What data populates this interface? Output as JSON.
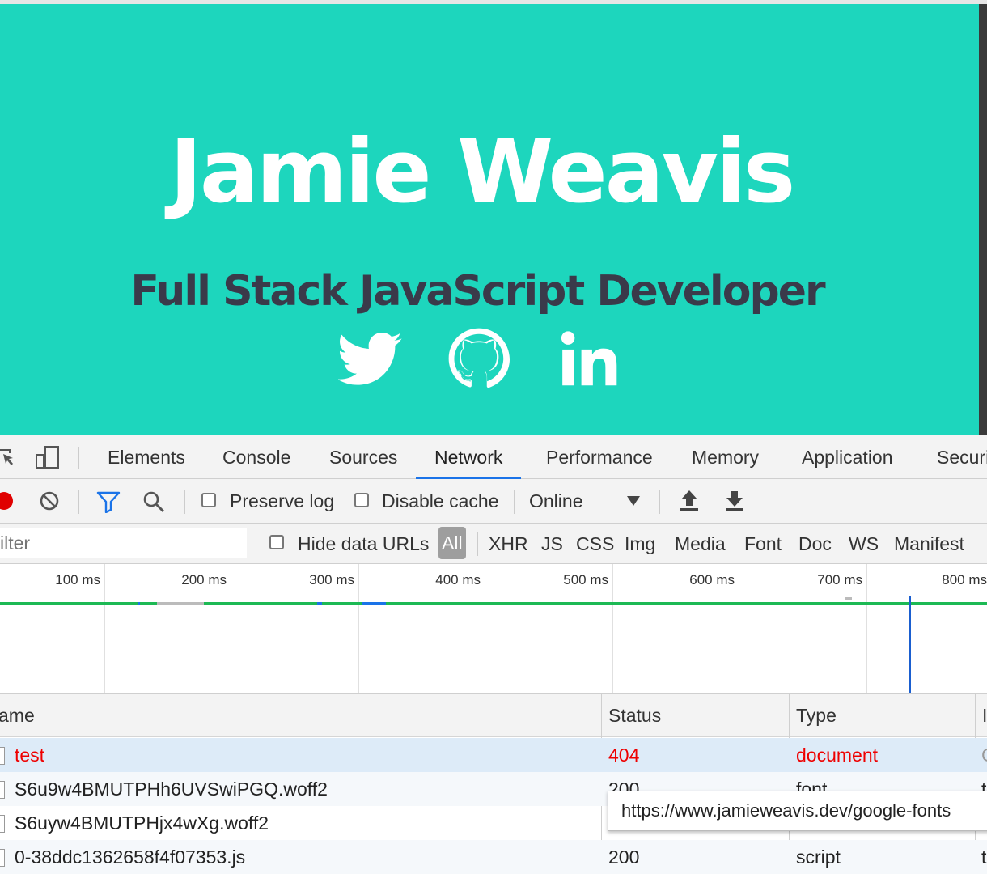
{
  "hero": {
    "background": "#1dd6bd",
    "name": "Jamie Weavis",
    "subtitle": "Full Stack JavaScript Developer",
    "social_icons": [
      "twitter-icon",
      "github-icon",
      "linkedin-icon"
    ]
  },
  "devtools": {
    "tabs": [
      "Elements",
      "Console",
      "Sources",
      "Network",
      "Performance",
      "Memory",
      "Application",
      "Securi"
    ],
    "active_tab": "Network",
    "toolbar": {
      "preserve_log": "Preserve log",
      "disable_cache": "Disable cache",
      "throttle": "Online"
    },
    "filter": {
      "placeholder": "ilter",
      "hide_data_urls": "Hide data URLs",
      "types": [
        "All",
        "XHR",
        "JS",
        "CSS",
        "Img",
        "Media",
        "Font",
        "Doc",
        "WS",
        "Manifest"
      ]
    },
    "timeline_ticks": [
      "100 ms",
      "200 ms",
      "300 ms",
      "400 ms",
      "500 ms",
      "600 ms",
      "700 ms",
      "800 ms"
    ],
    "columns": [
      "ame",
      "Status",
      "Type"
    ],
    "rows": [
      {
        "name": "test",
        "status": "404",
        "type": "document",
        "extra": "C"
      },
      {
        "name": "S6u9w4BMUTPHh6UVSwiPGQ.woff2",
        "status": "200",
        "type": "font",
        "extra": "t"
      },
      {
        "name": "S6uyw4BMUTPHjx4wXg.woff2",
        "status": "200",
        "type": "font",
        "extra": "s"
      },
      {
        "name": "0-38ddc1362658f4f07353.js",
        "status": "200",
        "type": "script",
        "extra": "t"
      }
    ],
    "tooltip": "https://www.jamieweavis.dev/google-fonts"
  },
  "colors": {
    "hero_bg": "#1dd6bd",
    "subtitle": "#3a3a4a",
    "active_tab_underline": "#1a73e8",
    "record": "#e00000",
    "filter_icon": "#1a73e8",
    "error_text": "#ee0000",
    "timeline_green": "#1db954",
    "timeline_blue": "#1a5fd0",
    "selected_row": "#ddebf8"
  }
}
